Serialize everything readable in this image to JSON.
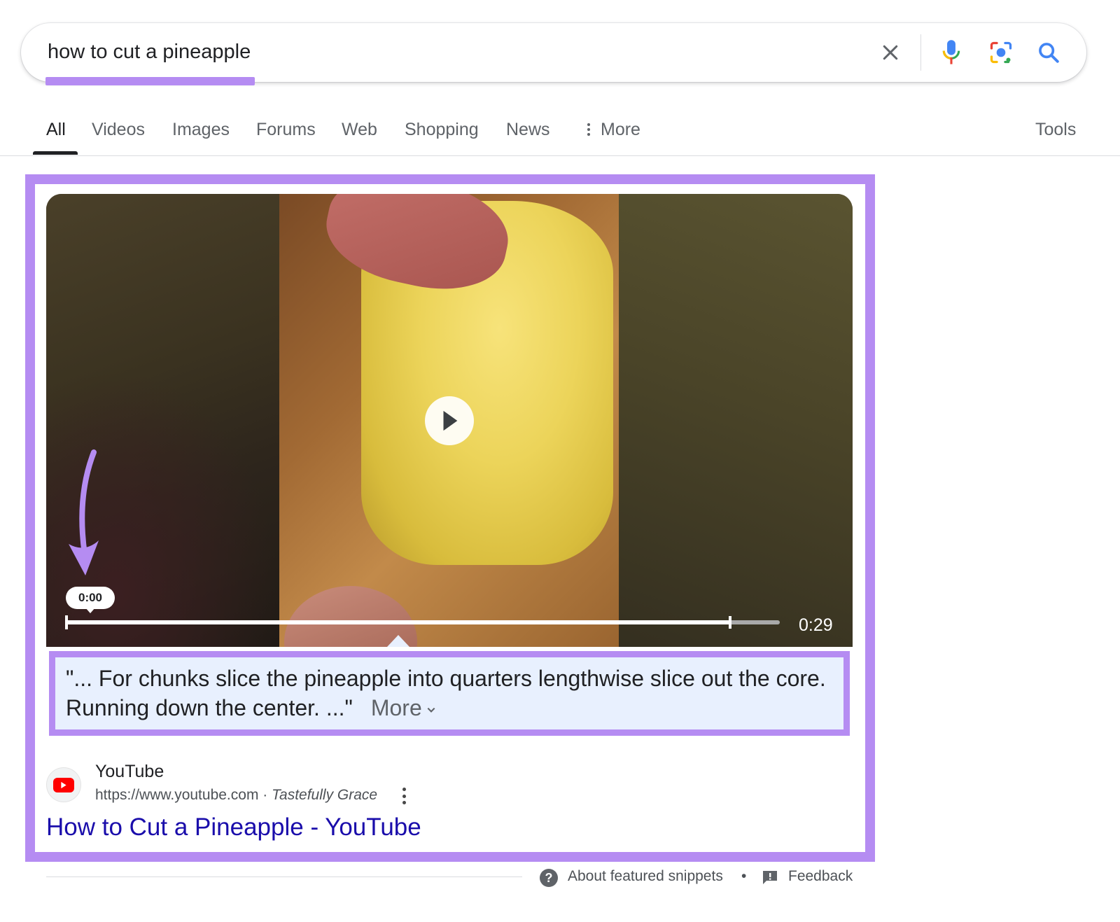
{
  "search": {
    "query": "how to cut a pineapple",
    "icons": [
      "close-icon",
      "microphone-icon",
      "lens-icon",
      "search-icon"
    ]
  },
  "tabs": {
    "items": [
      {
        "label": "All",
        "active": true
      },
      {
        "label": "Videos"
      },
      {
        "label": "Images"
      },
      {
        "label": "Forums"
      },
      {
        "label": "Web"
      },
      {
        "label": "Shopping"
      },
      {
        "label": "News"
      },
      {
        "label": "More",
        "icon": "vertical-dots-icon"
      }
    ],
    "tools_label": "Tools"
  },
  "video": {
    "current_time": "0:00",
    "duration": "0:29",
    "progress_fraction": 0.93,
    "play_icon": "play-icon"
  },
  "transcript": {
    "quote": "\"... For chunks slice the pineapple into quarters lengthwise slice out the core. Running down the center. ...\"",
    "more_label": "More"
  },
  "source": {
    "name": "YouTube",
    "url": "https://www.youtube.com",
    "separator": " · ",
    "author": "Tastefully Grace",
    "title": "How to Cut a Pineapple - YouTube"
  },
  "footer": {
    "about_label": "About featured snippets",
    "dot": "•",
    "feedback_label": "Feedback"
  },
  "colors": {
    "highlight": "#b58cf2",
    "link": "#1a0dab",
    "quote_bg": "#e8f0fe"
  }
}
